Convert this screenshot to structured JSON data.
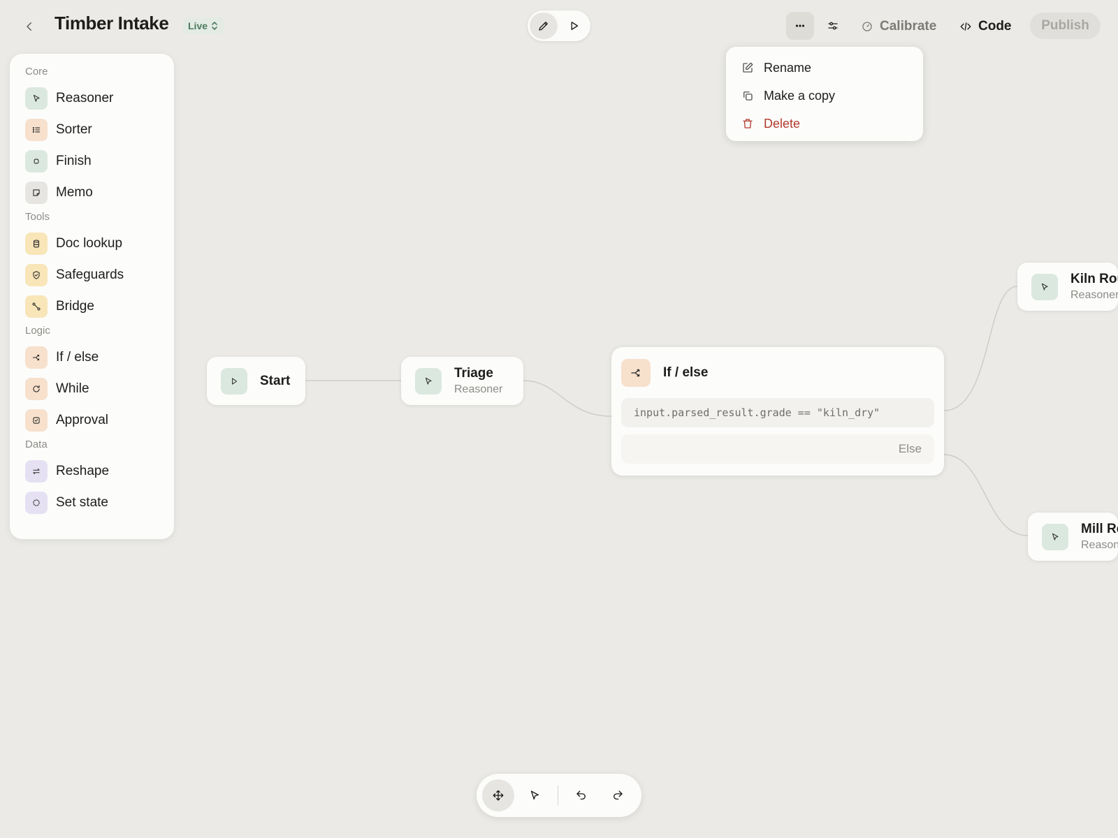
{
  "header": {
    "title": "Timber Intake",
    "status": "Live",
    "calibrate_label": "Calibrate",
    "code_label": "Code",
    "publish_label": "Publish"
  },
  "menu": {
    "rename": "Rename",
    "copy": "Make a copy",
    "delete": "Delete"
  },
  "palette": {
    "sections": [
      {
        "label": "Core",
        "items": [
          {
            "label": "Reasoner",
            "icon": "cursor-icon",
            "color": "#dbe8df"
          },
          {
            "label": "Sorter",
            "icon": "list-icon",
            "color": "#f7e0cc"
          },
          {
            "label": "Finish",
            "icon": "stop-icon",
            "color": "#dbe8df"
          },
          {
            "label": "Memo",
            "icon": "note-icon",
            "color": "#e6e5e1"
          }
        ]
      },
      {
        "label": "Tools",
        "items": [
          {
            "label": "Doc lookup",
            "icon": "database-icon",
            "color": "#f8e5b8"
          },
          {
            "label": "Safeguards",
            "icon": "shield-icon",
            "color": "#f8e5b8"
          },
          {
            "label": "Bridge",
            "icon": "connector-icon",
            "color": "#f8e5b8"
          }
        ]
      },
      {
        "label": "Logic",
        "items": [
          {
            "label": "If / else",
            "icon": "branch-icon",
            "color": "#f7e0cc"
          },
          {
            "label": "While",
            "icon": "loop-icon",
            "color": "#f7e0cc"
          },
          {
            "label": "Approval",
            "icon": "check-square-icon",
            "color": "#f7e0cc"
          }
        ]
      },
      {
        "label": "Data",
        "items": [
          {
            "label": "Reshape",
            "icon": "swap-icon",
            "color": "#e5e0f2"
          },
          {
            "label": "Set state",
            "icon": "dashed-circle-icon",
            "color": "#e5e0f2"
          }
        ]
      }
    ]
  },
  "canvas": {
    "start": {
      "title": "Start"
    },
    "triage": {
      "title": "Triage",
      "subtitle": "Reasoner"
    },
    "ifelse": {
      "title": "If / else",
      "condition": "input.parsed_result.grade == \"kiln_dry\"",
      "else_label": "Else"
    },
    "kiln": {
      "title": "Kiln Rou",
      "subtitle": "Reasoner"
    },
    "mill": {
      "title": "Mill Ro",
      "subtitle": "Reason"
    }
  },
  "colors": {
    "accent_green": "#dbe8df",
    "accent_orange": "#f7e0cc",
    "accent_yellow": "#f8e5b8",
    "accent_purple": "#e5e0f2",
    "danger": "#b13a2b",
    "live": "#4d7a5e"
  }
}
